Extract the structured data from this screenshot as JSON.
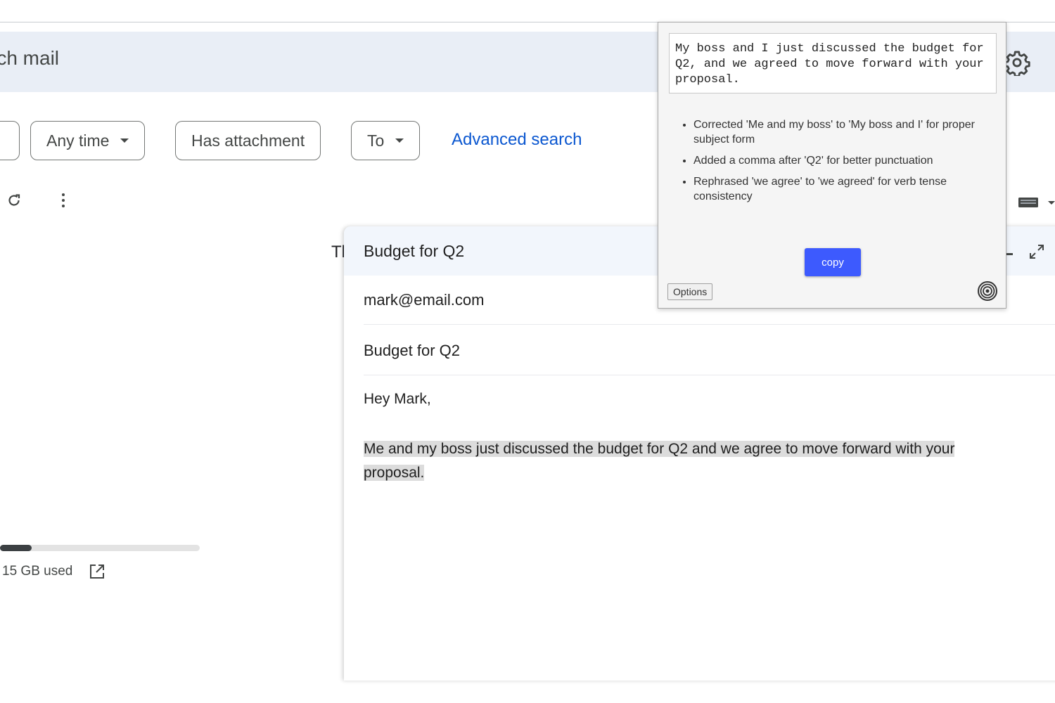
{
  "search": {
    "text": "rch mail"
  },
  "filters": {
    "any_time": "Any time",
    "has_attachment": "Has attachment",
    "to": "To",
    "advanced_search": "Advanced search"
  },
  "icons": {
    "settings": "gear-icon",
    "refresh": "refresh-icon",
    "more": "more-vert-icon",
    "external": "open-in-new-icon",
    "keyboard": "keyboard-icon",
    "minimize": "minimize-icon",
    "expand": "expand-icon",
    "fingerprint": "fingerprint-icon"
  },
  "colors": {
    "accent_blue": "#0b57d0",
    "copy_button": "#3d5afe",
    "search_bg": "#e9eef6",
    "compose_header_bg": "#f2f6fc"
  },
  "list": {
    "edge_text": "Tl"
  },
  "storage": {
    "used_text": "15 GB used",
    "fill_fraction": 0.16
  },
  "compose": {
    "title": "Budget for Q2",
    "to": "mark@email.com",
    "subject": "Budget for Q2",
    "greeting": "Hey Mark,",
    "selected_text": "Me and my boss just discussed the budget for Q2 and we agree to move forward with your proposal."
  },
  "popup": {
    "corrected_text": "My boss and I just discussed the budget for Q2, and we agreed to move forward with your proposal.",
    "changes": [
      "Corrected 'Me and my boss' to 'My boss and I' for proper subject form",
      "Added a comma after 'Q2' for better punctuation",
      "Rephrased 'we agree' to 'we agreed' for verb tense consistency"
    ],
    "copy_label": "copy",
    "options_label": "Options"
  }
}
